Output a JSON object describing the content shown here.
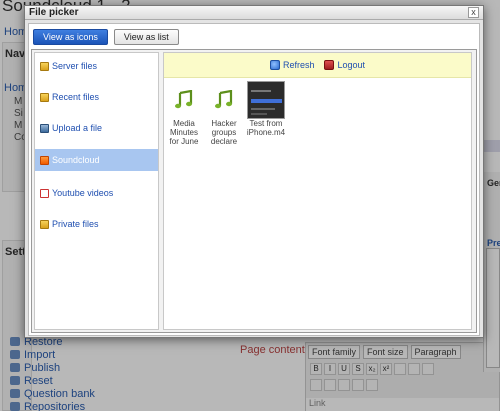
{
  "background": {
    "page_title": "Soundcloud 1 - 2",
    "home_link_1": "Home",
    "navigation_heading": "Navi",
    "home_link_2": "Home",
    "side_items": [
      "M",
      "Si",
      "M",
      "Co"
    ],
    "settings_heading": "Setti",
    "admin_items": [
      "Restore",
      "Import",
      "Publish",
      "Reset",
      "Question bank",
      "Repositories"
    ],
    "page_content_label": "Page content",
    "required_mark": "*",
    "editor": {
      "font_family": "Font family",
      "font_size": "Font size",
      "paragraph": "Paragraph",
      "format_buttons": [
        "B",
        "I",
        "U",
        "S",
        "x₂",
        "x²"
      ],
      "body_text": "Link"
    },
    "right_panel": {
      "general_label": "Gen",
      "preview_label": "Prev"
    }
  },
  "dialog": {
    "title": "File picker",
    "close_label": "x",
    "view_tabs": [
      {
        "label": "View as icons",
        "active": true
      },
      {
        "label": "View as list",
        "active": false
      }
    ],
    "repositories": [
      {
        "label": "Server files",
        "icon": "folder-icon"
      },
      {
        "label": "Recent files",
        "icon": "folder-icon"
      },
      {
        "label": "Upload a file",
        "icon": "upload-icon"
      },
      {
        "label": "Soundcloud",
        "icon": "soundcloud-icon",
        "active": true
      },
      {
        "label": "Youtube videos",
        "icon": "youtube-icon"
      },
      {
        "label": "Private files",
        "icon": "folder-icon"
      }
    ],
    "toolbar": {
      "refresh_label": "Refresh",
      "logout_label": "Logout"
    },
    "files": [
      {
        "name": "Media Minutes for June",
        "type": "audio",
        "icon": "music-note-icon"
      },
      {
        "name": "Hacker groups declare",
        "type": "audio",
        "icon": "music-note-icon"
      },
      {
        "name": "Test from iPhone.m4",
        "type": "video",
        "icon": "thumbnail"
      }
    ],
    "colors": {
      "active_tab": "#1b54b8",
      "selected_repo": "#a8c6f0",
      "toolbar_bg": "#fbfbc9",
      "link": "#1f4fb0"
    }
  }
}
